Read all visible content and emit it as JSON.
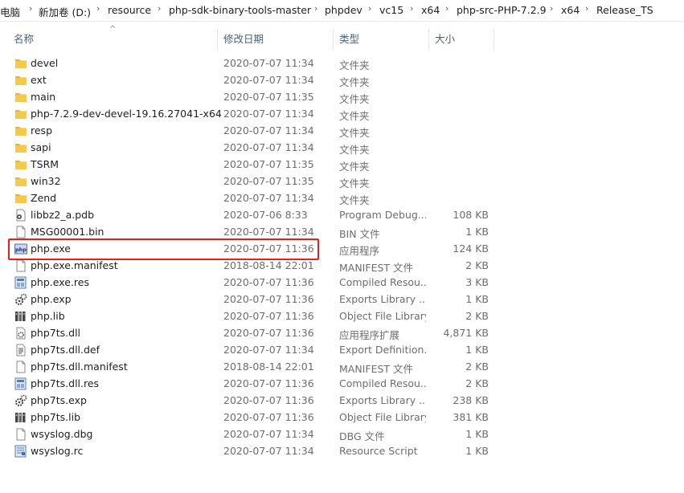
{
  "breadcrumb": [
    "电脑",
    "新加卷 (D:)",
    "resource",
    "php-sdk-binary-tools-master",
    "phpdev",
    "vc15",
    "x64",
    "php-src-PHP-7.2.9",
    "x64",
    "Release_TS"
  ],
  "columns": {
    "name": "名称",
    "date": "修改日期",
    "type": "类型",
    "size": "大小"
  },
  "files": [
    {
      "name": "devel",
      "date": "2020-07-07 11:34",
      "type": "文件夹",
      "size": "",
      "icon": "folder-icon"
    },
    {
      "name": "ext",
      "date": "2020-07-07 11:34",
      "type": "文件夹",
      "size": "",
      "icon": "folder-icon"
    },
    {
      "name": "main",
      "date": "2020-07-07 11:35",
      "type": "文件夹",
      "size": "",
      "icon": "folder-icon"
    },
    {
      "name": "php-7.2.9-dev-devel-19.16.27041-x64",
      "date": "2020-07-07 11:34",
      "type": "文件夹",
      "size": "",
      "icon": "folder-icon"
    },
    {
      "name": "resp",
      "date": "2020-07-07 11:34",
      "type": "文件夹",
      "size": "",
      "icon": "folder-icon"
    },
    {
      "name": "sapi",
      "date": "2020-07-07 11:34",
      "type": "文件夹",
      "size": "",
      "icon": "folder-icon"
    },
    {
      "name": "TSRM",
      "date": "2020-07-07 11:35",
      "type": "文件夹",
      "size": "",
      "icon": "folder-icon"
    },
    {
      "name": "win32",
      "date": "2020-07-07 11:35",
      "type": "文件夹",
      "size": "",
      "icon": "folder-icon"
    },
    {
      "name": "Zend",
      "date": "2020-07-07 11:34",
      "type": "文件夹",
      "size": "",
      "icon": "folder-icon"
    },
    {
      "name": "libbz2_a.pdb",
      "date": "2020-07-06 8:33",
      "type": "Program Debug...",
      "size": "108 KB",
      "icon": "pdb-file-icon"
    },
    {
      "name": "MSG00001.bin",
      "date": "2020-07-07 11:34",
      "type": "BIN 文件",
      "size": "1 KB",
      "icon": "blank-file-icon"
    },
    {
      "name": "php.exe",
      "date": "2020-07-07 11:36",
      "type": "应用程序",
      "size": "124 KB",
      "icon": "php-exe-icon"
    },
    {
      "name": "php.exe.manifest",
      "date": "2018-08-14 22:01",
      "type": "MANIFEST 文件",
      "size": "2 KB",
      "icon": "blank-file-icon"
    },
    {
      "name": "php.exe.res",
      "date": "2020-07-07 11:36",
      "type": "Compiled Resou...",
      "size": "3 KB",
      "icon": "resource-file-icon"
    },
    {
      "name": "php.exp",
      "date": "2020-07-07 11:36",
      "type": "Exports Library ...",
      "size": "1 KB",
      "icon": "gears-file-icon"
    },
    {
      "name": "php.lib",
      "date": "2020-07-07 11:36",
      "type": "Object File Library",
      "size": "2 KB",
      "icon": "library-file-icon"
    },
    {
      "name": "php7ts.dll",
      "date": "2020-07-07 11:36",
      "type": "应用程序扩展",
      "size": "4,871 KB",
      "icon": "dll-file-icon"
    },
    {
      "name": "php7ts.dll.def",
      "date": "2020-07-07 11:34",
      "type": "Export Definition...",
      "size": "1 KB",
      "icon": "text-file-icon"
    },
    {
      "name": "php7ts.dll.manifest",
      "date": "2018-08-14 22:01",
      "type": "MANIFEST 文件",
      "size": "2 KB",
      "icon": "blank-file-icon"
    },
    {
      "name": "php7ts.dll.res",
      "date": "2020-07-07 11:36",
      "type": "Compiled Resou...",
      "size": "2 KB",
      "icon": "resource-file-icon"
    },
    {
      "name": "php7ts.exp",
      "date": "2020-07-07 11:36",
      "type": "Exports Library ...",
      "size": "238 KB",
      "icon": "gears-file-icon"
    },
    {
      "name": "php7ts.lib",
      "date": "2020-07-07 11:36",
      "type": "Object File Library",
      "size": "381 KB",
      "icon": "library-file-icon"
    },
    {
      "name": "wsyslog.dbg",
      "date": "2020-07-07 11:34",
      "type": "DBG 文件",
      "size": "1 KB",
      "icon": "blank-file-icon"
    },
    {
      "name": "wsyslog.rc",
      "date": "2020-07-07 11:34",
      "type": "Resource Script",
      "size": "1 KB",
      "icon": "script-file-icon"
    }
  ],
  "highlighted_file": "php.exe",
  "colors": {
    "highlight_border": "#e0241c",
    "folder": "#f7c94b",
    "header_text": "#4c607a",
    "secondary_text": "#6d6d6d"
  }
}
